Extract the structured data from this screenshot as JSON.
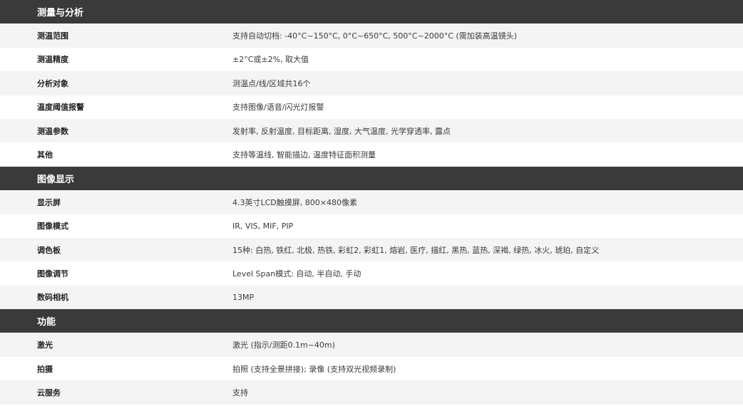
{
  "sections": [
    {
      "title": "测量与分析",
      "rows": [
        {
          "label": "测温范围",
          "value": "支持自动切档: -40°C~150°C, 0°C~650°C, 500°C~2000°C (需加装高温镜头)"
        },
        {
          "label": "测温精度",
          "value": "±2°C或±2%, 取大值"
        },
        {
          "label": "分析对象",
          "value": "测温点/线/区域共16个"
        },
        {
          "label": "温度阈值报警",
          "value": "支持图像/语音/闪光灯报警"
        },
        {
          "label": "测温参数",
          "value": "发射率, 反射温度, 目标距离, 湿度, 大气温度, 光学穿透率, 露点"
        },
        {
          "label": "其他",
          "value": "支持等温线, 智能描边, 温度特征面积测量"
        }
      ]
    },
    {
      "title": "图像显示",
      "rows": [
        {
          "label": "显示屏",
          "value": "4.3英寸LCD触摸屏, 800×480像素"
        },
        {
          "label": "图像模式",
          "value": "IR, VIS, MIF, PIP"
        },
        {
          "label": "调色板",
          "value": "15种: 白热, 铁红, 北极, 热铁, 彩虹2, 彩虹1, 熔岩, 医疗, 描红, 黑热, 蓝热, 深褐, 绿热, 冰火, 琥珀, 自定义"
        },
        {
          "label": "图像调节",
          "value": "Level Span模式: 自动, 半自动, 手动"
        },
        {
          "label": "数码相机",
          "value": "13MP"
        }
      ]
    },
    {
      "title": "功能",
      "rows": [
        {
          "label": "激光",
          "value": "激光 (指示/测距0.1m~40m)"
        },
        {
          "label": "拍摄",
          "value": "拍照 (支持全景拼接); 录像 (支持双光视频录制)"
        },
        {
          "label": "云服务",
          "value": "支持"
        }
      ]
    }
  ]
}
